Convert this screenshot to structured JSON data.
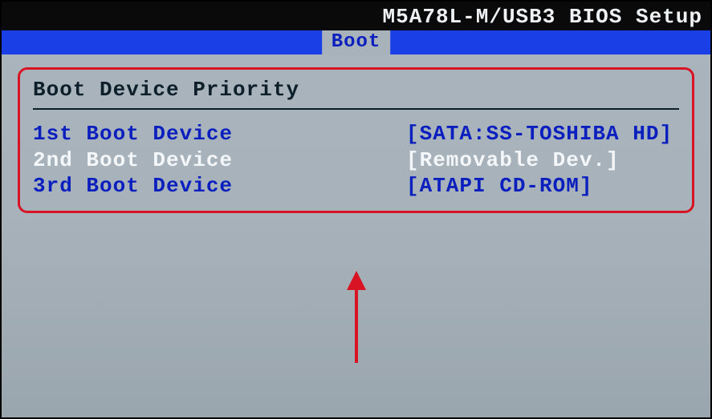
{
  "header": {
    "title": "M5A78L-M/USB3 BIOS Setup"
  },
  "menu": {
    "active_tab": "Boot"
  },
  "section": {
    "title": "Boot Device Priority",
    "rows": [
      {
        "label": "1st Boot Device",
        "value": "[SATA:SS-TOSHIBA HD]",
        "selected": false
      },
      {
        "label": "2nd Boot Device",
        "value": "[Removable Dev.]",
        "selected": true
      },
      {
        "label": "3rd Boot Device",
        "value": "[ATAPI CD-ROM]",
        "selected": false
      }
    ]
  },
  "annotation": {
    "arrow_color": "#d81324"
  }
}
